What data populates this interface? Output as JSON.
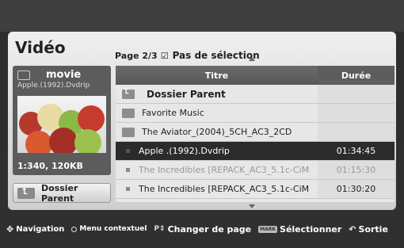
{
  "header": {
    "title": "Vidéo"
  },
  "page_info": {
    "page": "Page 2/3",
    "checkbox_icon": "check-icon",
    "selection": "Pas de sélection"
  },
  "preview": {
    "type": "movie",
    "filename": "Apple.(1992).Dvdrip",
    "info": "1:340, 120KB"
  },
  "parent_button": {
    "label": "Dossier Parent"
  },
  "list": {
    "headers": {
      "title": "Titre",
      "duration": "Durée"
    },
    "rows": [
      {
        "name": "Dossier Parent",
        "duration": ""
      },
      {
        "name": "Favorite Music",
        "duration": ""
      },
      {
        "name": "The Aviator_(2004)_5CH_AC3_2CD",
        "duration": ""
      },
      {
        "name": "Apple .(1992).Dvdrip",
        "duration": "01:34:45"
      },
      {
        "name": "The Incredibles [REPACK_AC3_5.1c-CiM",
        "duration": "01:15:30"
      },
      {
        "name": "The Incredibles [REPACK_AC3_5.1c-CiM",
        "duration": "01:30:20"
      }
    ]
  },
  "footer": {
    "navigation": "Navigation",
    "context": "Menu contextuel",
    "page": "Changer de page",
    "mark_icon_text": "MARK",
    "select": "Sélectionner",
    "exit": "Sortie"
  }
}
